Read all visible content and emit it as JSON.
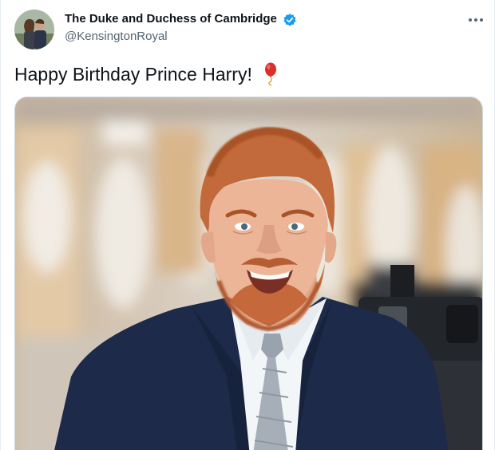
{
  "tweet": {
    "display_name": "The Duke and Duchess of Cambridge",
    "handle": "@KensingtonRoyal",
    "text": "Happy Birthday Prince Harry!",
    "emoji_icon": "balloon-icon",
    "verified_icon": "verified-badge-icon",
    "more_icon": "more-options-icon"
  },
  "colors": {
    "text_primary": "#0f1419",
    "text_secondary": "#536471",
    "verified_blue": "#1d9bf0",
    "balloon_red": "#d9302c",
    "suit_navy": "#1e2a4a"
  }
}
